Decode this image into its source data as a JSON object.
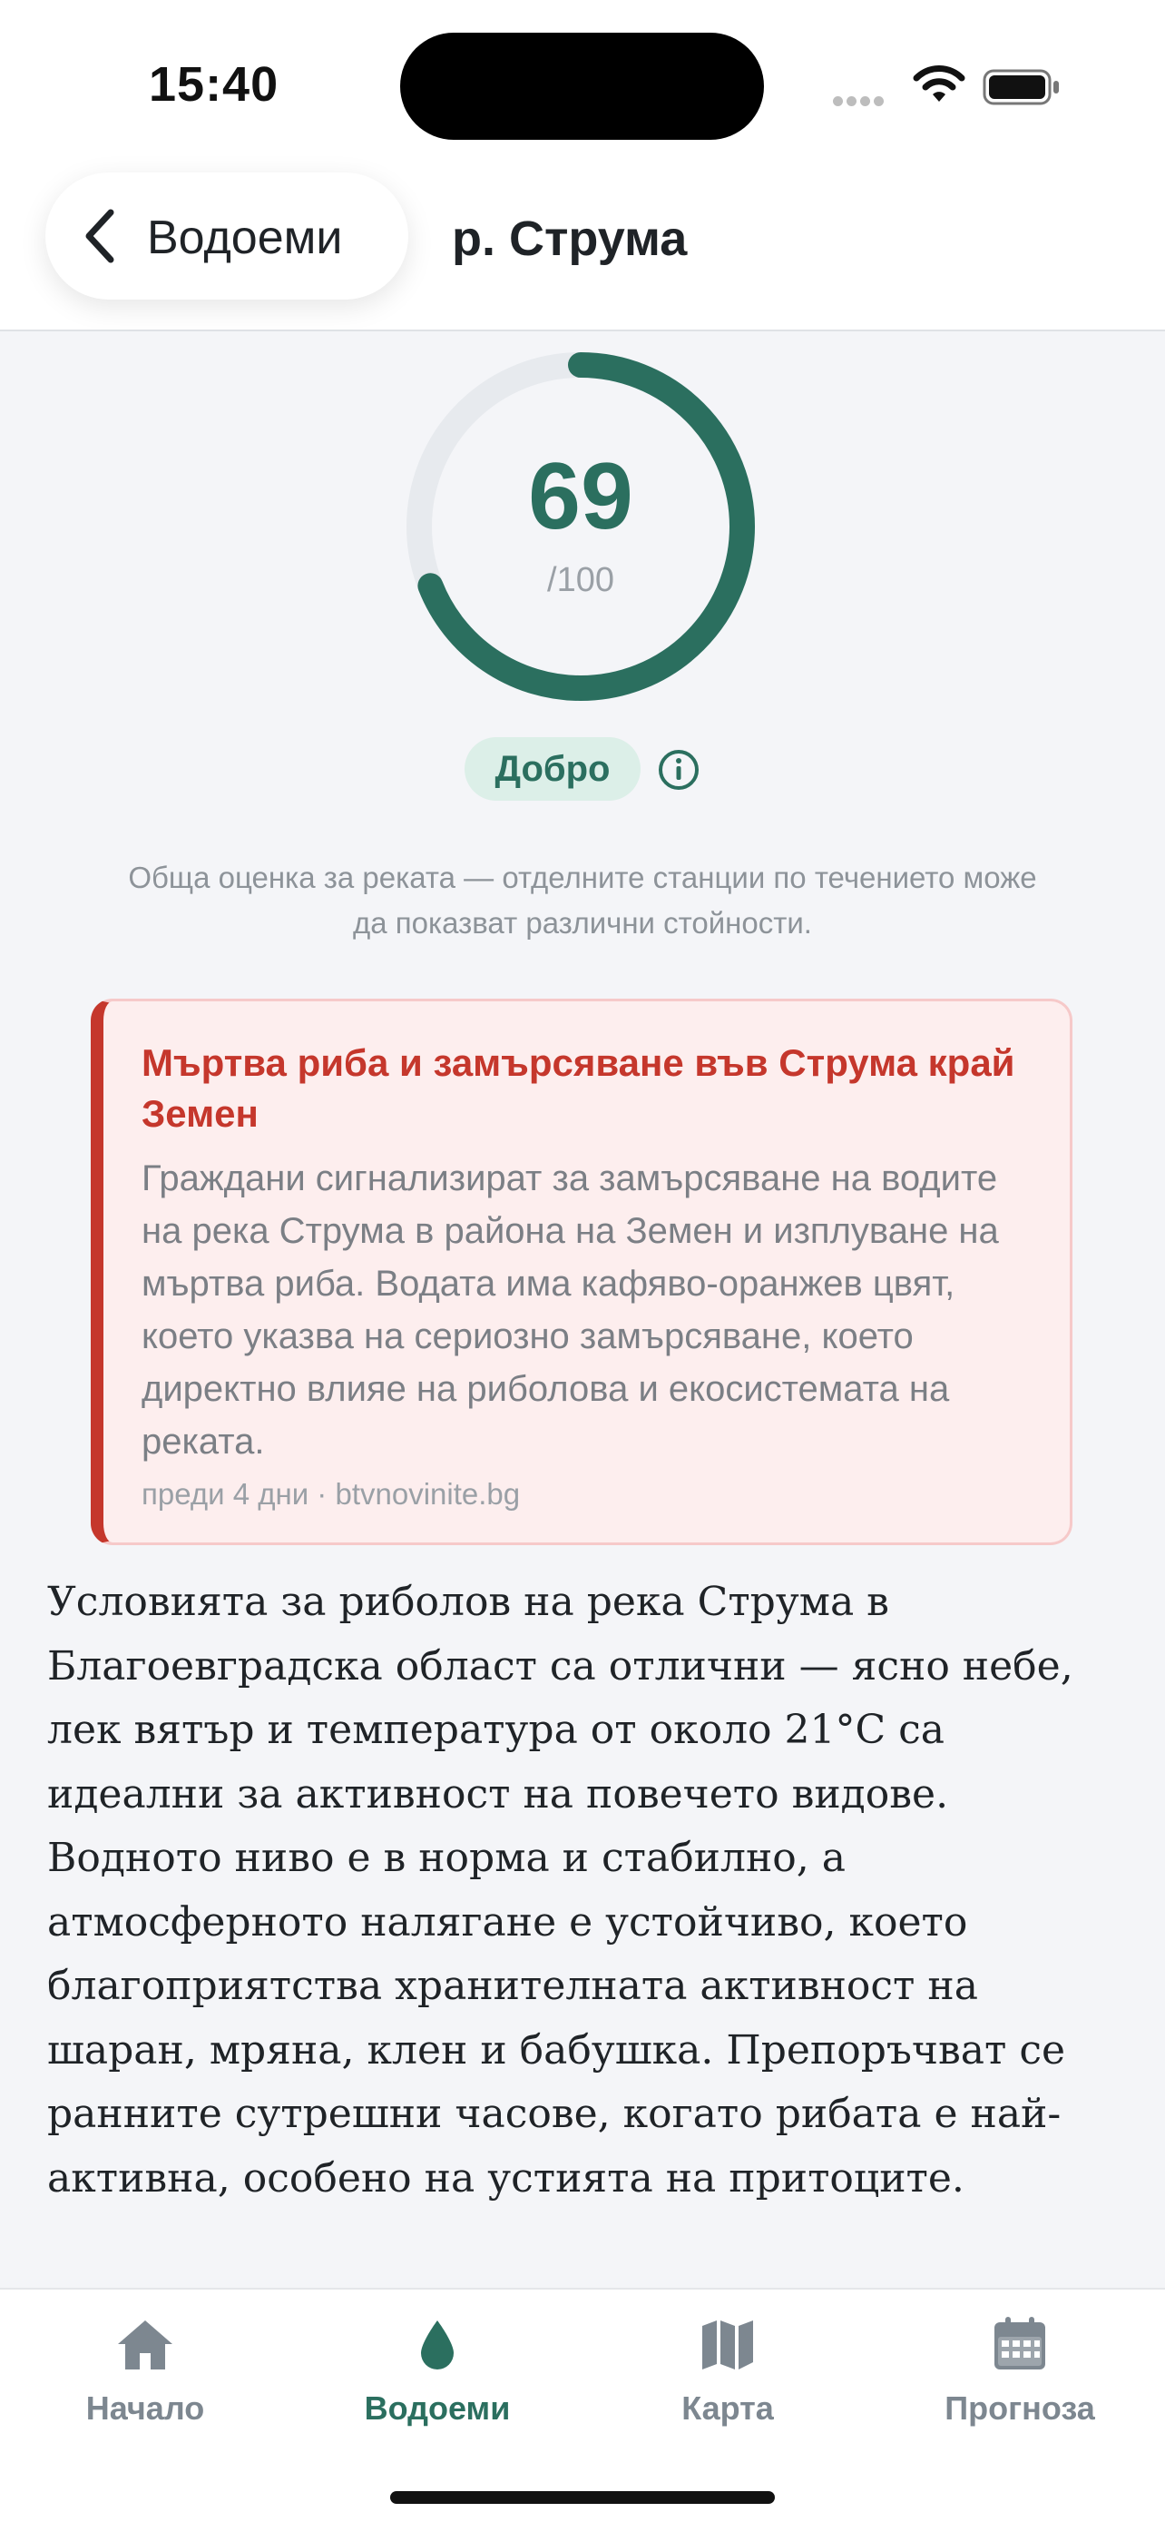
{
  "status_bar": {
    "time": "15:40"
  },
  "header": {
    "back_label": "Водоеми",
    "title": "р. Струма"
  },
  "score": {
    "value": "69",
    "max_label": "/100",
    "fraction": 0.69,
    "rating": "Добро",
    "note": "Обща оценка за реката — отделните станции по течението може да показват различни стойности."
  },
  "alert": {
    "title": "Мъртва риба и замърсяване във Струма край Земен",
    "body": "Граждани сигнализират за замърсяване на водите на река Струма в района на Земен и изплуване на мъртва риба. Водата има кафяво-оранжев цвят, което указва на сериозно замърсяване, което директно влияе на риболова и екосистемата на реката.",
    "meta": "преди 4 дни · btvnovinite.bg"
  },
  "description": "Условията за риболов на река Струма в Благоевградска област са отлични — ясно небе, лек вятър и температура от около 21°C са идеални за активност на повечето видове. Водното ниво е в норма и стабилно, а атмосферното налягане е устойчиво, което благоприятства хранителната активност на шаран, мряна, клен и бабушка. Препоръчват се ранните сутрешни часове, когато рибата е най-активна, особено на устията на притоците.",
  "tabs": [
    {
      "label": "Начало",
      "icon": "home-icon",
      "active": false
    },
    {
      "label": "Водоеми",
      "icon": "water-drop-icon",
      "active": true
    },
    {
      "label": "Карта",
      "icon": "map-icon",
      "active": false
    },
    {
      "label": "Прогноза",
      "icon": "calendar-icon",
      "active": false
    }
  ],
  "colors": {
    "accent": "#2b6f5f",
    "gauge_track": "#e7eaee",
    "alert": "#c5372c",
    "alert_bg": "#fdeeee",
    "inactive_tab": "#7d8790"
  }
}
